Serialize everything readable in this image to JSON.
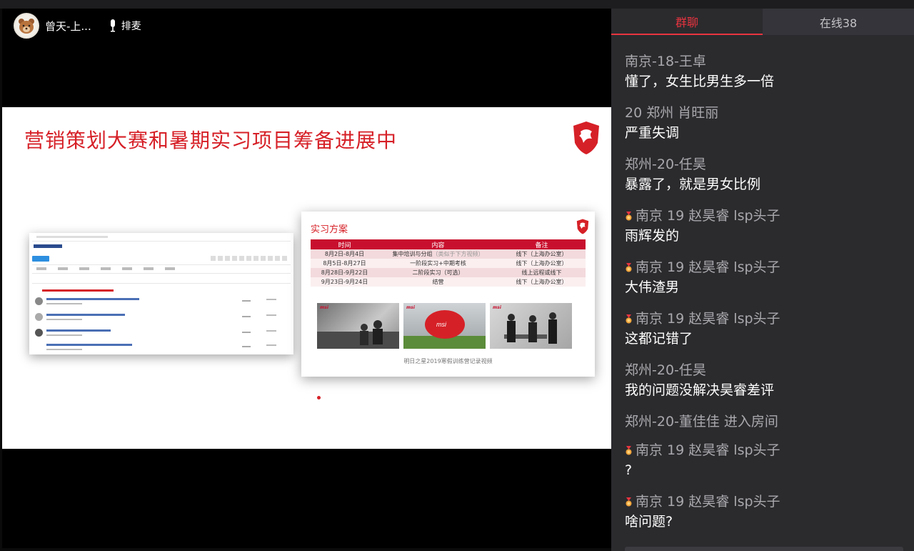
{
  "host": {
    "name": "曾天-上...",
    "mic_label": "排麦"
  },
  "slide": {
    "title": "营销策划大赛和暑期实习项目筹备进展中",
    "internship": {
      "title": "实习方案",
      "columns": [
        "时间",
        "内容",
        "备注"
      ],
      "rows": [
        {
          "time": "8月2日-8月4日",
          "content": "集中培训与分组",
          "content_note": "（类似于下方视频）",
          "remark": "线下（上海办公室）"
        },
        {
          "time": "8月5日-8月27日",
          "content": "一阶段实习+中期考核",
          "content_note": "",
          "remark": "线下（上海办公室）"
        },
        {
          "time": "8月28日-9月22日",
          "content": "二阶段实习（可选）",
          "content_note": "",
          "remark": "线上远程或线下"
        },
        {
          "time": "9月23日-9月24日",
          "content": "结营",
          "content_note": "",
          "remark": "线下（上海办公室）"
        }
      ],
      "photo_brand": "msi",
      "caption": "明日之星2019寒假训练营记录视频"
    }
  },
  "chat": {
    "tabs": {
      "group": "群聊",
      "online": "在线38"
    },
    "messages": [
      {
        "name": "南京-18-王卓",
        "text": "懂了，女生比男生多一倍",
        "badge": false
      },
      {
        "name": "20 郑州 肖旺丽",
        "text": "严重失调",
        "badge": false
      },
      {
        "name": "郑州-20-任昊",
        "text": "暴露了，就是男女比例",
        "badge": false
      },
      {
        "name": "南京 19 赵昊睿 lsp头子",
        "text": "雨辉发的",
        "badge": true
      },
      {
        "name": "南京 19 赵昊睿 lsp头子",
        "text": "大伟渣男",
        "badge": true
      },
      {
        "name": "南京 19 赵昊睿 lsp头子",
        "text": "这都记错了",
        "badge": true
      },
      {
        "name": "郑州-20-任昊",
        "text": "我的问题没解决昊睿差评",
        "badge": false
      }
    ],
    "system": "郑州-20-董佳佳 进入房间",
    "messages2": [
      {
        "name": "南京 19 赵昊睿 lsp头子",
        "text": "?",
        "badge": true
      },
      {
        "name": "南京 19 赵昊睿 lsp头子",
        "text": "啥问题?",
        "badge": true
      }
    ],
    "colors": {
      "accent": "#e8343f",
      "panel": "#2b2b2e"
    }
  }
}
